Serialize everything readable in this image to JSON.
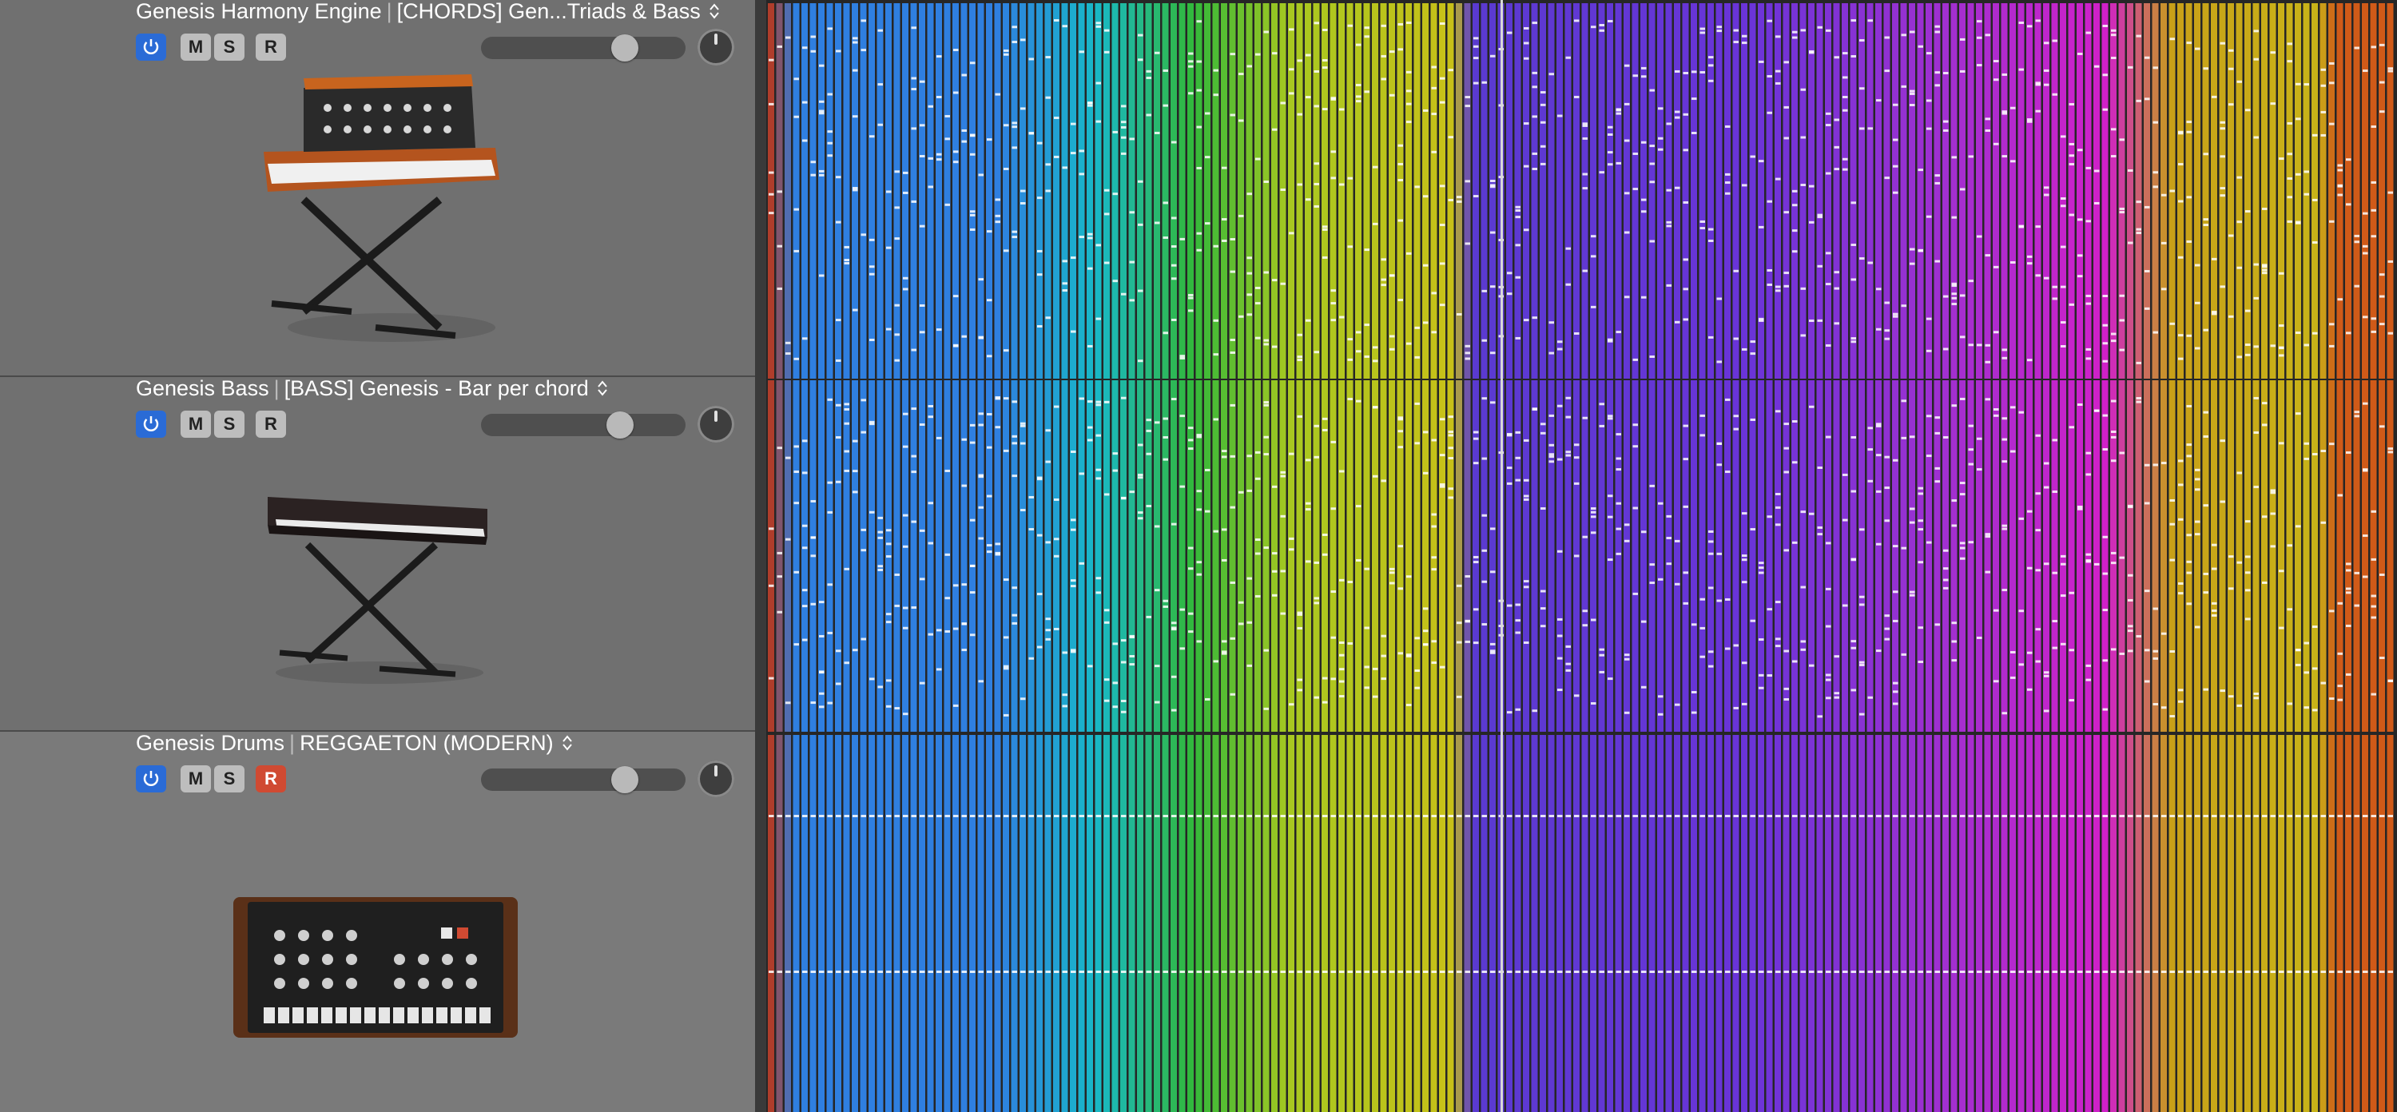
{
  "tracks": [
    {
      "name": "Genesis Harmony Engine",
      "region": "[CHORDS] Gen...Triads & Bass",
      "buttons": {
        "mute": "M",
        "solo": "S",
        "record": "R"
      },
      "record_enabled": false,
      "volume_level": 0.74,
      "instrument_icon": "synth-keyboard-icon"
    },
    {
      "name": "Genesis Bass",
      "region": "[BASS] Genesis -  Bar per chord",
      "buttons": {
        "mute": "M",
        "solo": "S",
        "record": "R"
      },
      "record_enabled": false,
      "volume_level": 0.72,
      "instrument_icon": "stage-keyboard-icon"
    },
    {
      "name": "Genesis Drums",
      "region": "REGGAETON (MODERN)",
      "buttons": {
        "mute": "M",
        "solo": "S",
        "record": "R"
      },
      "record_enabled": true,
      "volume_level": 0.74,
      "instrument_icon": "drum-machine-icon"
    }
  ],
  "colors": {
    "power_active": "#2a6bd6",
    "record_active": "#d04a32",
    "header_bg": "#707070",
    "region_palette": [
      "#b8381e",
      "#2f7fe0",
      "#18b8c8",
      "#32b83a",
      "#a8c820",
      "#c8c018",
      "#5a3ad0",
      "#6a34d8",
      "#a030d0",
      "#d020c8",
      "#c8a018",
      "#d05a18"
    ]
  }
}
